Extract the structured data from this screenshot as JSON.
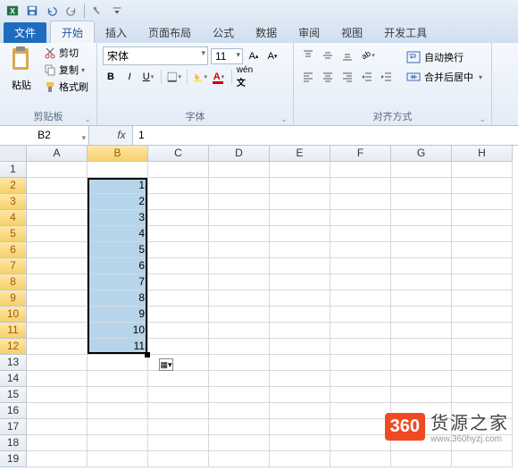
{
  "qat": {
    "excel": "X"
  },
  "tabs": {
    "file": "文件",
    "items": [
      "开始",
      "插入",
      "页面布局",
      "公式",
      "数据",
      "审阅",
      "视图",
      "开发工具"
    ],
    "active": 0
  },
  "ribbon": {
    "clipboard": {
      "paste": "粘贴",
      "cut": "剪切",
      "copy": "复制",
      "format_painter": "格式刷",
      "label": "剪贴板"
    },
    "font": {
      "name": "宋体",
      "size": "11",
      "label": "字体"
    },
    "alignment": {
      "label": "对齐方式",
      "wrap": "自动换行",
      "merge": "合并后居中"
    }
  },
  "namebox": "B2",
  "formula_label": "fx",
  "formula": "1",
  "columns": [
    "A",
    "B",
    "C",
    "D",
    "E",
    "F",
    "G",
    "H"
  ],
  "rows": [
    1,
    2,
    3,
    4,
    5,
    6,
    7,
    8,
    9,
    10,
    11,
    12,
    13,
    14,
    15,
    16,
    17,
    18,
    19
  ],
  "chart_data": {
    "type": "table",
    "selection": "B2:B12",
    "active_cell": "B2",
    "cells": {
      "B2": 1,
      "B3": 2,
      "B4": 3,
      "B5": 4,
      "B6": 5,
      "B7": 6,
      "B8": 7,
      "B9": 8,
      "B10": 9,
      "B11": 10,
      "B12": 11
    }
  },
  "watermark": {
    "badge": "360",
    "title": "货源之家",
    "url": "www.360hyzj.com"
  }
}
